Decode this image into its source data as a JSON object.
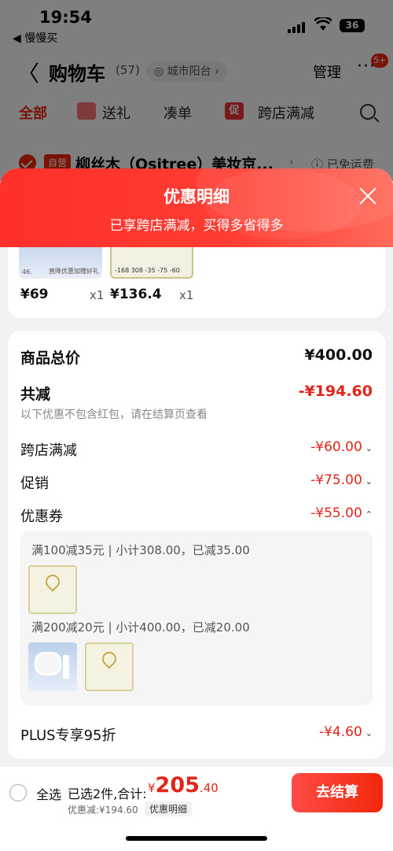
{
  "status": {
    "time": "19:54",
    "back_app": "◀ 慢慢买",
    "battery": "36"
  },
  "nav": {
    "title": "购物车",
    "count": "(57)",
    "location": "城市阳台",
    "manage": "管理",
    "more_badge": "5+"
  },
  "tabs": [
    {
      "label": "全部"
    },
    {
      "label": "送礼"
    },
    {
      "label": "凑单"
    },
    {
      "label": "跨店满减"
    }
  ],
  "tab_promo_icon": "促",
  "shop": {
    "tag": "自营",
    "name": "柳丝木（Ositree）美妆京...",
    "shipping": "已免运费"
  },
  "modal": {
    "title": "优惠明细",
    "subtitle": "已享跨店满减，买得多省得多"
  },
  "items": [
    {
      "price": "¥69",
      "qty": "x1",
      "thumb_text": "直降优惠加赠好礼"
    },
    {
      "price": "¥136.4",
      "qty": "x1",
      "thumb_text": "-168  308 -35  -75  -60"
    }
  ],
  "details": {
    "total_label": "商品总价",
    "total_value": "¥400.00",
    "discount_label": "共减",
    "discount_value": "-¥194.60",
    "discount_note": "以下优惠不包含红包，请在结算页查看",
    "cross_store_label": "跨店满减",
    "cross_store_value": "-¥60.00",
    "promo_label": "促销",
    "promo_value": "-¥75.00",
    "coupon_label": "优惠券",
    "coupon_value": "-¥55.00",
    "coupon_lines": [
      "满100减35元 | 小计308.00，已减35.00",
      "满200减20元 | 小计400.00，已减20.00"
    ],
    "plus_label": "PLUS专享95折",
    "plus_value": "-¥4.60"
  },
  "checkout": {
    "select_all": "全选",
    "selected": "已选2件,合计:",
    "currency": "¥",
    "total_int": "205",
    "total_dec": ".40",
    "saved": "优惠减:¥194.60",
    "saved_btn": "优惠明细",
    "button": "去结算"
  },
  "colors": {
    "accent": "#f2270c",
    "price_red": "#e1251b"
  }
}
